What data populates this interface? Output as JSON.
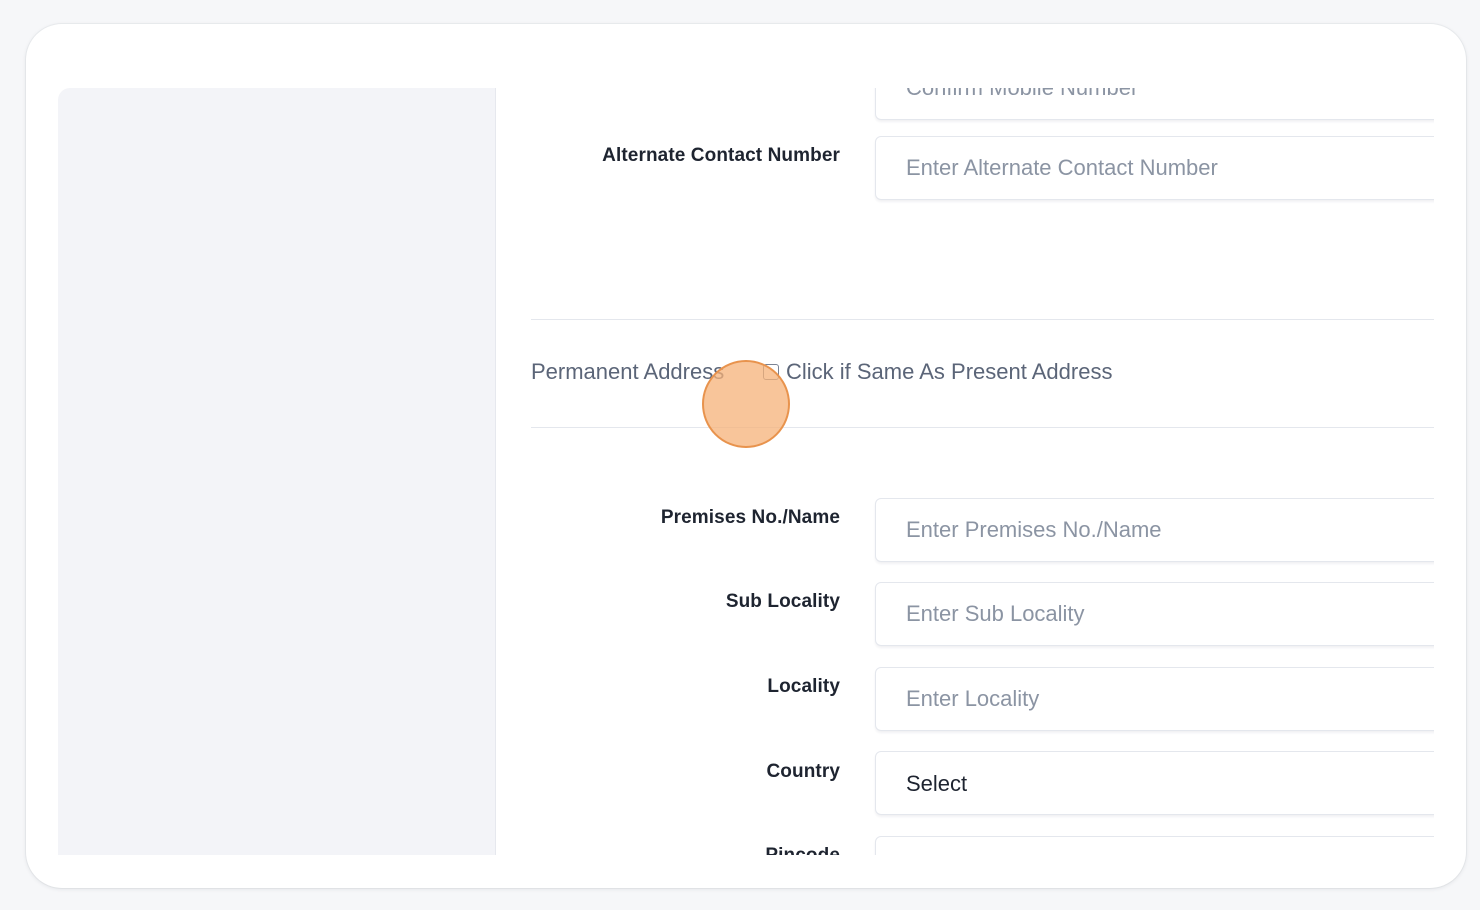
{
  "form": {
    "confirm_mobile": {
      "placeholder": "Confirm Mobile Number"
    },
    "alternate_contact": {
      "label": "Alternate Contact Number",
      "placeholder": "Enter Alternate Contact Number"
    },
    "permanent_address": {
      "title": "Permanent Address",
      "same_as_present_label": "Click if Same As Present Address",
      "same_as_present_checked": false
    },
    "premises": {
      "label": "Premises No./Name",
      "placeholder": "Enter Premises No./Name"
    },
    "sub_locality": {
      "label": "Sub Locality",
      "placeholder": "Enter Sub Locality"
    },
    "locality": {
      "label": "Locality",
      "placeholder": "Enter Locality"
    },
    "country": {
      "label": "Country",
      "value": "Select"
    },
    "pincode": {
      "label": "Pincode"
    }
  },
  "colors": {
    "cursor_highlight": "#f5b278",
    "label_text": "#1e2430",
    "placeholder_text": "#8b94a3",
    "section_text": "#5b6578"
  }
}
